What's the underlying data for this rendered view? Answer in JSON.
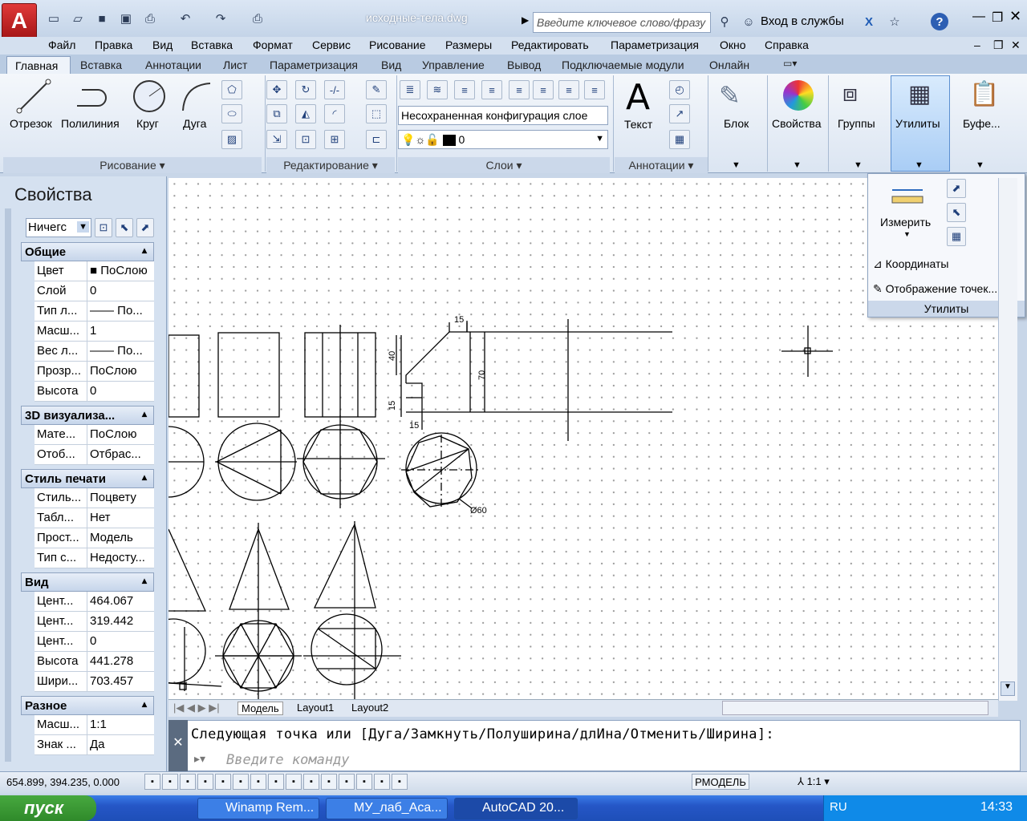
{
  "titlebar": {
    "doc_title": "исходные-тела.dwg",
    "search_placeholder": "Введите ключевое слово/фразу",
    "login": "Вход в службы"
  },
  "menu": [
    "Файл",
    "Правка",
    "Вид",
    "Вставка",
    "Формат",
    "Сервис",
    "Рисование",
    "Размеры",
    "Редактировать",
    "Параметризация",
    "Окно",
    "Справка"
  ],
  "tabs": [
    "Главная",
    "Вставка",
    "Аннотации",
    "Лист",
    "Параметризация",
    "Вид",
    "Управление",
    "Вывод",
    "Подключаемые модули",
    "Онлайн"
  ],
  "ribbon": {
    "draw": {
      "title": "Рисование",
      "line": "Отрезок",
      "polyline": "Полилиния",
      "circle": "Круг",
      "arc": "Дуга"
    },
    "modify": {
      "title": "Редактирование"
    },
    "layers": {
      "title": "Слои",
      "state": "Несохраненная конфигурация слое",
      "current": "0"
    },
    "annotation": {
      "title": "Аннотации",
      "text": "Текст"
    },
    "block": "Блок",
    "properties": "Свойства",
    "groups": "Группы",
    "utilities": "Утилиты",
    "clipboard": "Буфе..."
  },
  "flyout": {
    "measure": "Измерить",
    "coordinates": "Координаты",
    "point_display": "Отображение точек...",
    "title": "Утилиты"
  },
  "properties": {
    "title": "Свойства",
    "selection": "Ничегс",
    "sections": [
      {
        "name": "Общие",
        "rows": [
          [
            "Цвет",
            "■ ПоСлою"
          ],
          [
            "Слой",
            "0"
          ],
          [
            "Тип л...",
            "—— По..."
          ],
          [
            "Масш...",
            "1"
          ],
          [
            "Вес л...",
            "—— По..."
          ],
          [
            "Прозр...",
            "ПоСлою"
          ],
          [
            "Высота",
            "0"
          ]
        ]
      },
      {
        "name": "3D визуализа...",
        "rows": [
          [
            "Мате...",
            "ПоСлою"
          ],
          [
            "Отоб...",
            "Отбрас..."
          ]
        ]
      },
      {
        "name": "Стиль печати",
        "rows": [
          [
            "Стиль...",
            "Поцвету"
          ],
          [
            "Табл...",
            "Нет"
          ],
          [
            "Прост...",
            "Модель"
          ],
          [
            "Тип с...",
            "Недосту..."
          ]
        ]
      },
      {
        "name": "Вид",
        "rows": [
          [
            "Цент...",
            "464.067"
          ],
          [
            "Цент...",
            "319.442"
          ],
          [
            "Цент...",
            "0"
          ],
          [
            "Высота",
            "441.278"
          ],
          [
            "Шири...",
            "703.457"
          ]
        ]
      },
      {
        "name": "Разное",
        "rows": [
          [
            "Масш...",
            "1:1"
          ],
          [
            "Знак ...",
            "Да"
          ]
        ]
      }
    ]
  },
  "drawing": {
    "dims": [
      "15",
      "40",
      "70",
      "15",
      "15",
      "Ø60"
    ]
  },
  "layouts": [
    "Модель",
    "Layout1",
    "Layout2"
  ],
  "command": {
    "prompt": "Следующая точка или [Дуга/Замкнуть/Полуширина/длИна/Отменить/Ширина]:",
    "placeholder": "Введите команду"
  },
  "status": {
    "coords": "654.899, 394.235, 0.000",
    "model": "РМОДЕЛЬ",
    "scale": "1:1"
  },
  "taskbar": {
    "start": "пуск",
    "tasks": [
      "Winamp Rem...",
      "МУ_лаб_Aca...",
      "AutoCAD 20..."
    ],
    "lang": "RU",
    "clock": "14:33"
  }
}
